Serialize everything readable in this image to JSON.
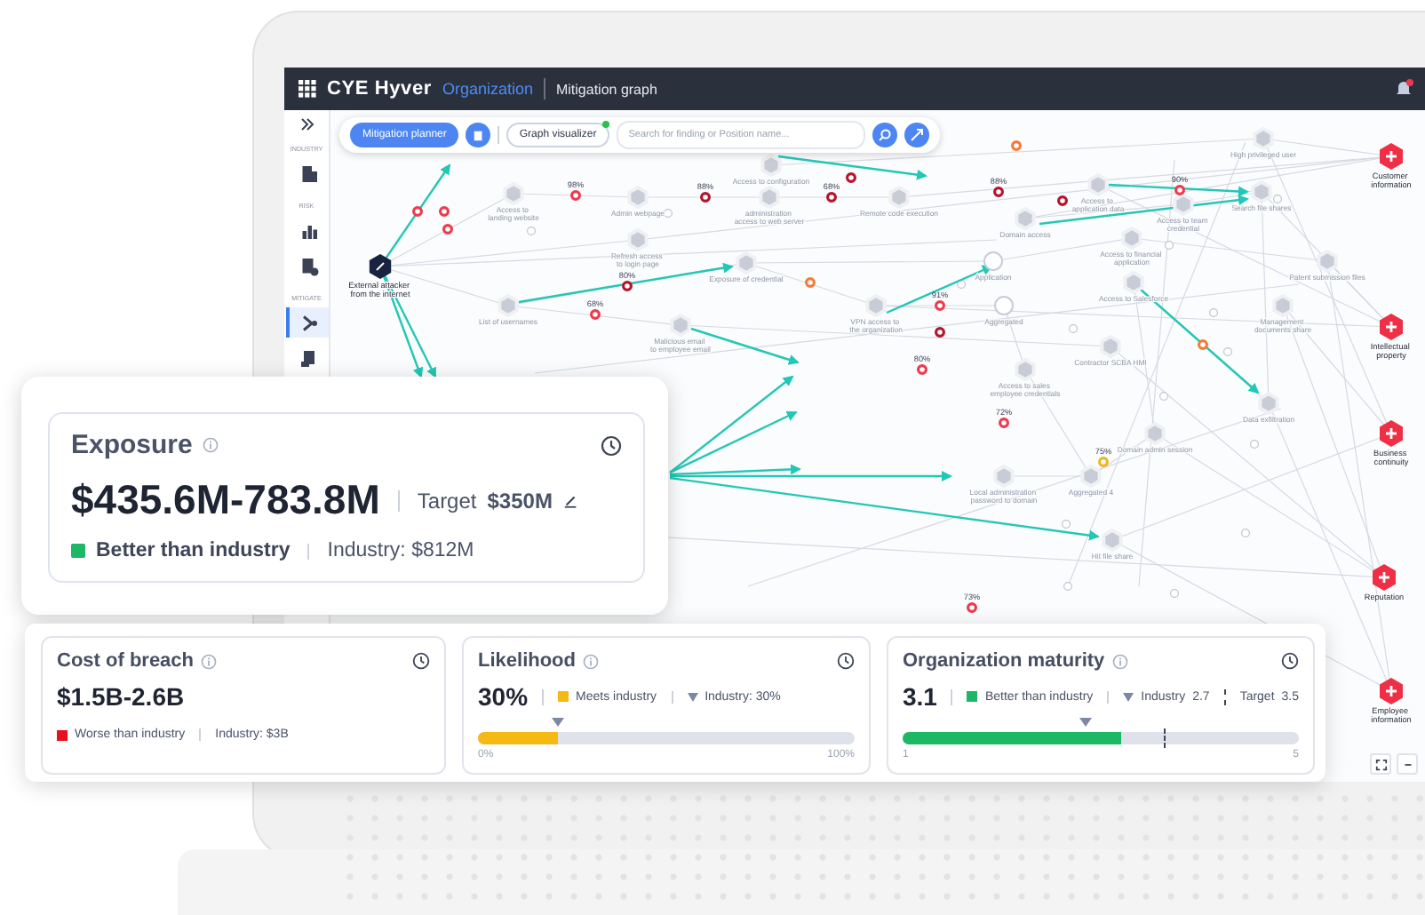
{
  "header": {
    "brand": "CYE Hyver",
    "workspace": "Organization",
    "page": "Mitigation graph",
    "notification": true
  },
  "sidebar": {
    "sections": [
      {
        "label": "INDUSTRY",
        "items": [
          {
            "selected": false
          }
        ]
      },
      {
        "label": "RISK",
        "items": [
          {
            "selected": false
          },
          {
            "selected": false
          }
        ]
      },
      {
        "label": "MITIGATE",
        "items": [
          {
            "selected": true
          },
          {
            "selected": false
          }
        ]
      }
    ]
  },
  "toolbar": {
    "modes": [
      {
        "label": "Mitigation planner",
        "selected": true,
        "indicator": false
      },
      {
        "label": "Graph visualizer",
        "selected": false,
        "indicator": true
      }
    ],
    "search": {
      "placeholder": "Search for finding or Position name..."
    }
  },
  "graph": {
    "nodes": [
      {
        "kind": "entry",
        "label": "External attacker from the internet"
      },
      {
        "kind": "asset",
        "label": "Access to landing website"
      },
      {
        "kind": "asset",
        "label": "Admin webpage"
      },
      {
        "kind": "asset",
        "label": "administration access to web server"
      },
      {
        "kind": "asset",
        "label": "Remote code execution"
      },
      {
        "kind": "asset",
        "label": "Refresh access to login page"
      },
      {
        "kind": "asset",
        "label": "Exposure of credential"
      },
      {
        "kind": "asset",
        "label": "List of usernames"
      },
      {
        "kind": "asset",
        "label": "Malicious email to employee email"
      },
      {
        "kind": "asset",
        "label": "Access to configuration"
      },
      {
        "kind": "asset",
        "label": "High privileged user"
      },
      {
        "kind": "asset",
        "label": "Access to application data"
      },
      {
        "kind": "asset",
        "label": "Search file shares"
      },
      {
        "kind": "asset",
        "label": "Access to team credential"
      },
      {
        "kind": "asset",
        "label": "Domain access"
      },
      {
        "kind": "asset",
        "label": "Access to financial application"
      },
      {
        "kind": "asset",
        "label": "Patent submission files"
      },
      {
        "kind": "asset",
        "label": "Access to Salesforce"
      },
      {
        "kind": "asset",
        "label": "Management documents share"
      },
      {
        "kind": "asset",
        "label": "Contractor SCBA HMI"
      },
      {
        "kind": "asset",
        "label": "Access to sales employee credentials"
      },
      {
        "kind": "asset",
        "label": "Data exfiltration"
      },
      {
        "kind": "asset",
        "label": "Domain admin session"
      },
      {
        "kind": "asset",
        "label": "Local administration password to domain"
      },
      {
        "kind": "asset",
        "label": "Aggregated 4"
      },
      {
        "kind": "asset",
        "label": "Hit file share"
      },
      {
        "kind": "asset",
        "label": "VPN access to the organization"
      },
      {
        "kind": "aggregate",
        "label": "Application"
      },
      {
        "kind": "aggregate",
        "label": "Aggregated"
      },
      {
        "kind": "impact",
        "label": "Customer information"
      },
      {
        "kind": "impact",
        "label": "Intellectual property"
      },
      {
        "kind": "impact",
        "label": "Business continuity"
      },
      {
        "kind": "impact",
        "label": "Reputation"
      },
      {
        "kind": "impact",
        "label": "Employee information"
      }
    ],
    "findings": [
      {
        "color": "#ef3a4d",
        "probability": "98%"
      },
      {
        "color": "#b5142b",
        "probability": "88%"
      },
      {
        "color": "#b5142b",
        "probability": "68%"
      },
      {
        "color": "#b5142b",
        "probability": "80%"
      },
      {
        "color": "#ef3a4d",
        "probability": "68%"
      },
      {
        "color": "#ef3a4d",
        "probability": "91%"
      },
      {
        "color": "#b5142b",
        "probability": "88%"
      },
      {
        "color": "#ef3a4d",
        "probability": "90%"
      },
      {
        "color": "#ef3a4d",
        "probability": "72%"
      },
      {
        "color": "#f2b51c",
        "probability": "75%"
      },
      {
        "color": "#ef3a4d",
        "probability": "73%"
      },
      {
        "color": "#ef3a4d",
        "probability": "80%"
      },
      {
        "color": "#ef3a4d"
      },
      {
        "color": "#ef3a4d"
      },
      {
        "color": "#ef3a4d"
      },
      {
        "color": "#b5142b"
      },
      {
        "color": "#f47b38"
      },
      {
        "color": "#f47b38"
      },
      {
        "color": "#b5142b"
      },
      {
        "color": "#b5142b"
      },
      {
        "color": "#f47b38"
      }
    ]
  },
  "exposure": {
    "title": "Exposure",
    "value": "$435.6M-783.8M",
    "target_label": "Target",
    "target": "$350M",
    "status": {
      "label": "Better than industry",
      "color": "#1db866"
    },
    "industry": "Industry: $812M"
  },
  "metrics": [
    {
      "kind": "plain",
      "title": "Cost of breach",
      "value": "$1.5B-2.6B",
      "status": {
        "label": "Worse than industry",
        "color": "#e8101c"
      },
      "industry": "Industry: $3B"
    },
    {
      "kind": "bar",
      "title": "Likelihood",
      "value": "30%",
      "status": {
        "label": "Meets industry",
        "color": "#f5b914"
      },
      "industry": "Industry: 30%",
      "fill": {
        "level": 0.21
      },
      "industry_marker": {
        "level": 0.21
      },
      "min": "0%",
      "max": "100%"
    },
    {
      "kind": "bar",
      "title": "Organization maturity",
      "value": "3.1",
      "status": {
        "label": "Better than industry",
        "color": "#1db866"
      },
      "industry_label": "Industry",
      "industry": "2.7",
      "target_label": "Target",
      "target": "3.5",
      "fill": {
        "level": 0.55
      },
      "industry_marker": {
        "level": 0.46
      },
      "target_marker": {
        "level": 0.66
      },
      "min": "1",
      "max": "5"
    }
  ]
}
